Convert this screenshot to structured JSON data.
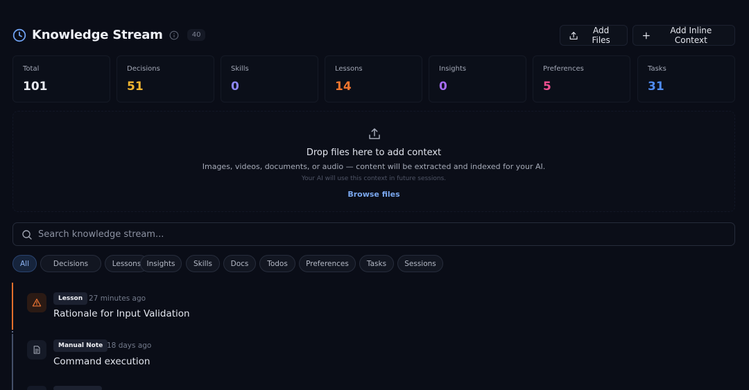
{
  "header": {
    "title": "Knowledge Stream",
    "count": "40",
    "add_files_label": "Add Files",
    "add_inline_label": "Add Inline Context"
  },
  "stats": [
    {
      "label": "Total",
      "value": "101",
      "color": "#e8eaf0"
    },
    {
      "label": "Decisions",
      "value": "51",
      "color": "#f2b631"
    },
    {
      "label": "Skills",
      "value": "0",
      "color": "#8d86f5"
    },
    {
      "label": "Lessons",
      "value": "14",
      "color": "#f2752e"
    },
    {
      "label": "Insights",
      "value": "0",
      "color": "#a66cf2"
    },
    {
      "label": "Preferences",
      "value": "5",
      "color": "#ef4f8f"
    },
    {
      "label": "Tasks",
      "value": "31",
      "color": "#4f8cf2"
    }
  ],
  "dropzone": {
    "title": "Drop files here to add context",
    "subtitle": "Images, videos, documents, or audio — content will be extracted and indexed for your AI.",
    "note": "Your AI will use this context in future sessions.",
    "link": "Browse files"
  },
  "search": {
    "placeholder": "Search knowledge stream..."
  },
  "filters": [
    "All",
    "Decisions",
    "Lessons",
    "Insights",
    "Skills",
    "Docs",
    "Todos",
    "Preferences",
    "Tasks",
    "Sessions"
  ],
  "entries": [
    {
      "tag": "Lesson",
      "time": "27 minutes ago",
      "title": "Rationale for Input Validation",
      "icon": "warning-icon"
    },
    {
      "tag": "Manual Note",
      "time": "18 days ago",
      "title": "Command execution",
      "icon": "document-icon"
    }
  ]
}
